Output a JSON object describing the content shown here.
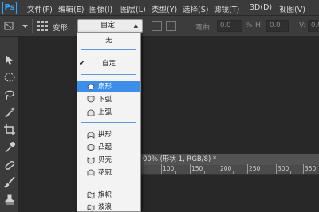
{
  "app": {
    "logo_text": "Ps"
  },
  "menu": [
    {
      "label": "文件(F)"
    },
    {
      "label": "编辑(E)"
    },
    {
      "label": "图像(I)"
    },
    {
      "label": "图层(L)"
    },
    {
      "label": "类型(Y)"
    },
    {
      "label": "选择(S)"
    },
    {
      "label": "滤镜(T)"
    },
    {
      "label": "3D(D)"
    },
    {
      "label": "视图(V)"
    }
  ],
  "options": {
    "warp_label": "变形:",
    "warp_value": "自定",
    "bend_label": "弯曲:",
    "bend_value": "0.0",
    "h_label": "H:",
    "h_value": "0.0",
    "pct_label": "%",
    "v_label": "V:",
    "v_value": "0.0"
  },
  "warp_menu": {
    "items": [
      {
        "label": "无",
        "icon": "none"
      },
      {
        "label": "自定",
        "icon": "none",
        "checked": true
      },
      {
        "label": "扇形",
        "icon": "arc-icon",
        "selected": true
      },
      {
        "label": "下弧",
        "icon": "arc-lower-icon"
      },
      {
        "label": "上弧",
        "icon": "arc-upper-icon"
      },
      {
        "label": "拱形",
        "icon": "arch-icon"
      },
      {
        "label": "凸起",
        "icon": "bulge-icon"
      },
      {
        "label": "贝壳",
        "icon": "shell-icon"
      },
      {
        "label": "花冠",
        "icon": "flower-icon"
      },
      {
        "label": "旗帜",
        "icon": "flag-icon"
      },
      {
        "label": "波浪",
        "icon": "wave-icon"
      }
    ],
    "check_mark": "✔"
  },
  "document": {
    "tab_title": "00% (形状 1, RGB/8) *"
  },
  "ruler": {
    "labels": [
      "100",
      "150",
      "200",
      "250",
      "300",
      "350"
    ]
  },
  "colors": {
    "accent": "#3c8ee8",
    "ps_blue": "#31a8ff",
    "menubar": "#3b3b3b",
    "canvas": "#282828"
  }
}
